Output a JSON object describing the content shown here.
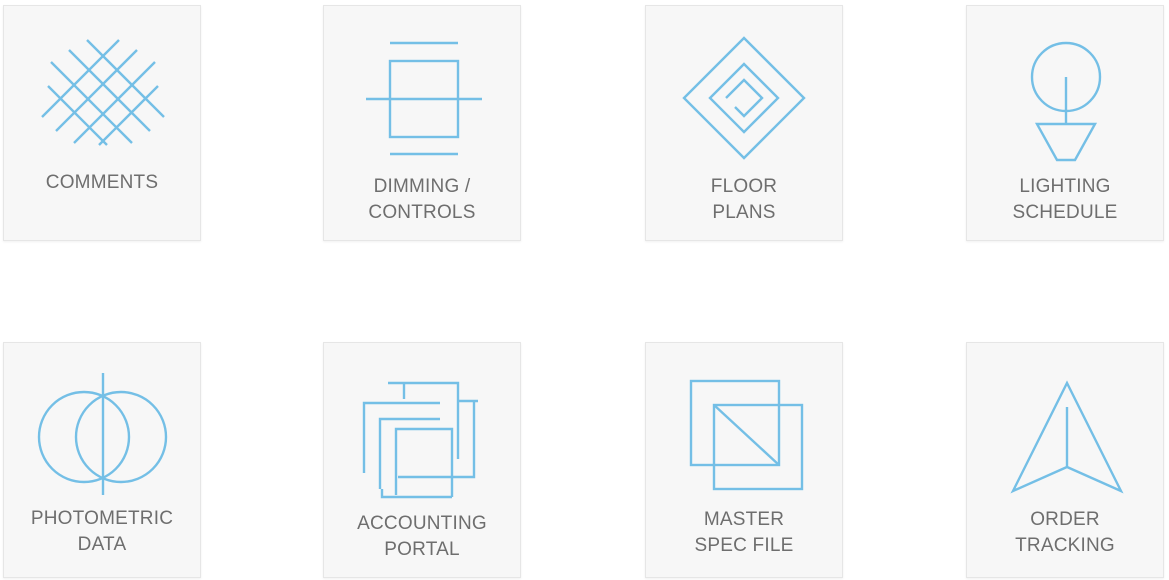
{
  "theme": {
    "icon_color": "#74bfe6",
    "label_color": "#6e6e6e",
    "tile_background": "#f7f7f7"
  },
  "tiles": [
    {
      "label": "COMMENTS",
      "icon": "crosshatch-icon"
    },
    {
      "label": "DIMMING /\nCONTROLS",
      "icon": "dimming-controls-icon"
    },
    {
      "label": "FLOOR\nPLANS",
      "icon": "floor-plans-icon"
    },
    {
      "label": "LIGHTING\nSCHEDULE",
      "icon": "lighting-schedule-icon"
    },
    {
      "label": "PHOTOMETRIC\nDATA",
      "icon": "photometric-data-icon"
    },
    {
      "label": "ACCOUNTING\nPORTAL",
      "icon": "accounting-portal-icon"
    },
    {
      "label": "MASTER\nSPEC FILE",
      "icon": "master-spec-file-icon"
    },
    {
      "label": "ORDER\nTRACKING",
      "icon": "order-tracking-icon"
    }
  ]
}
